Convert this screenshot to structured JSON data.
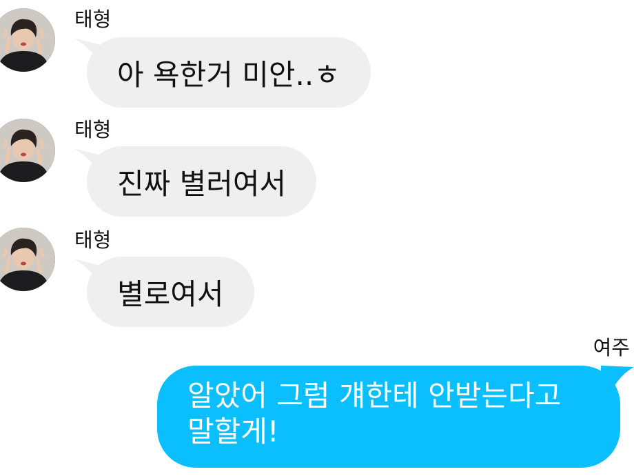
{
  "messages": [
    {
      "sender": "태형",
      "text": "아 욕한거 미안..ㅎ",
      "direction": "incoming"
    },
    {
      "sender": "태형",
      "text": "진짜 별러여서",
      "direction": "incoming"
    },
    {
      "sender": "태형",
      "text": "별로여서",
      "direction": "incoming"
    },
    {
      "sender": "여주",
      "lines": [
        "알았어 그럼 걔한테 안받는다고",
        "말할게!"
      ],
      "direction": "outgoing"
    }
  ],
  "colors": {
    "incoming_bubble": "#efefef",
    "outgoing_bubble": "#0bbfff",
    "text_dark": "#111111",
    "text_light": "#ffffff"
  },
  "icons": {
    "avatar": "profile-photo-avatar"
  }
}
